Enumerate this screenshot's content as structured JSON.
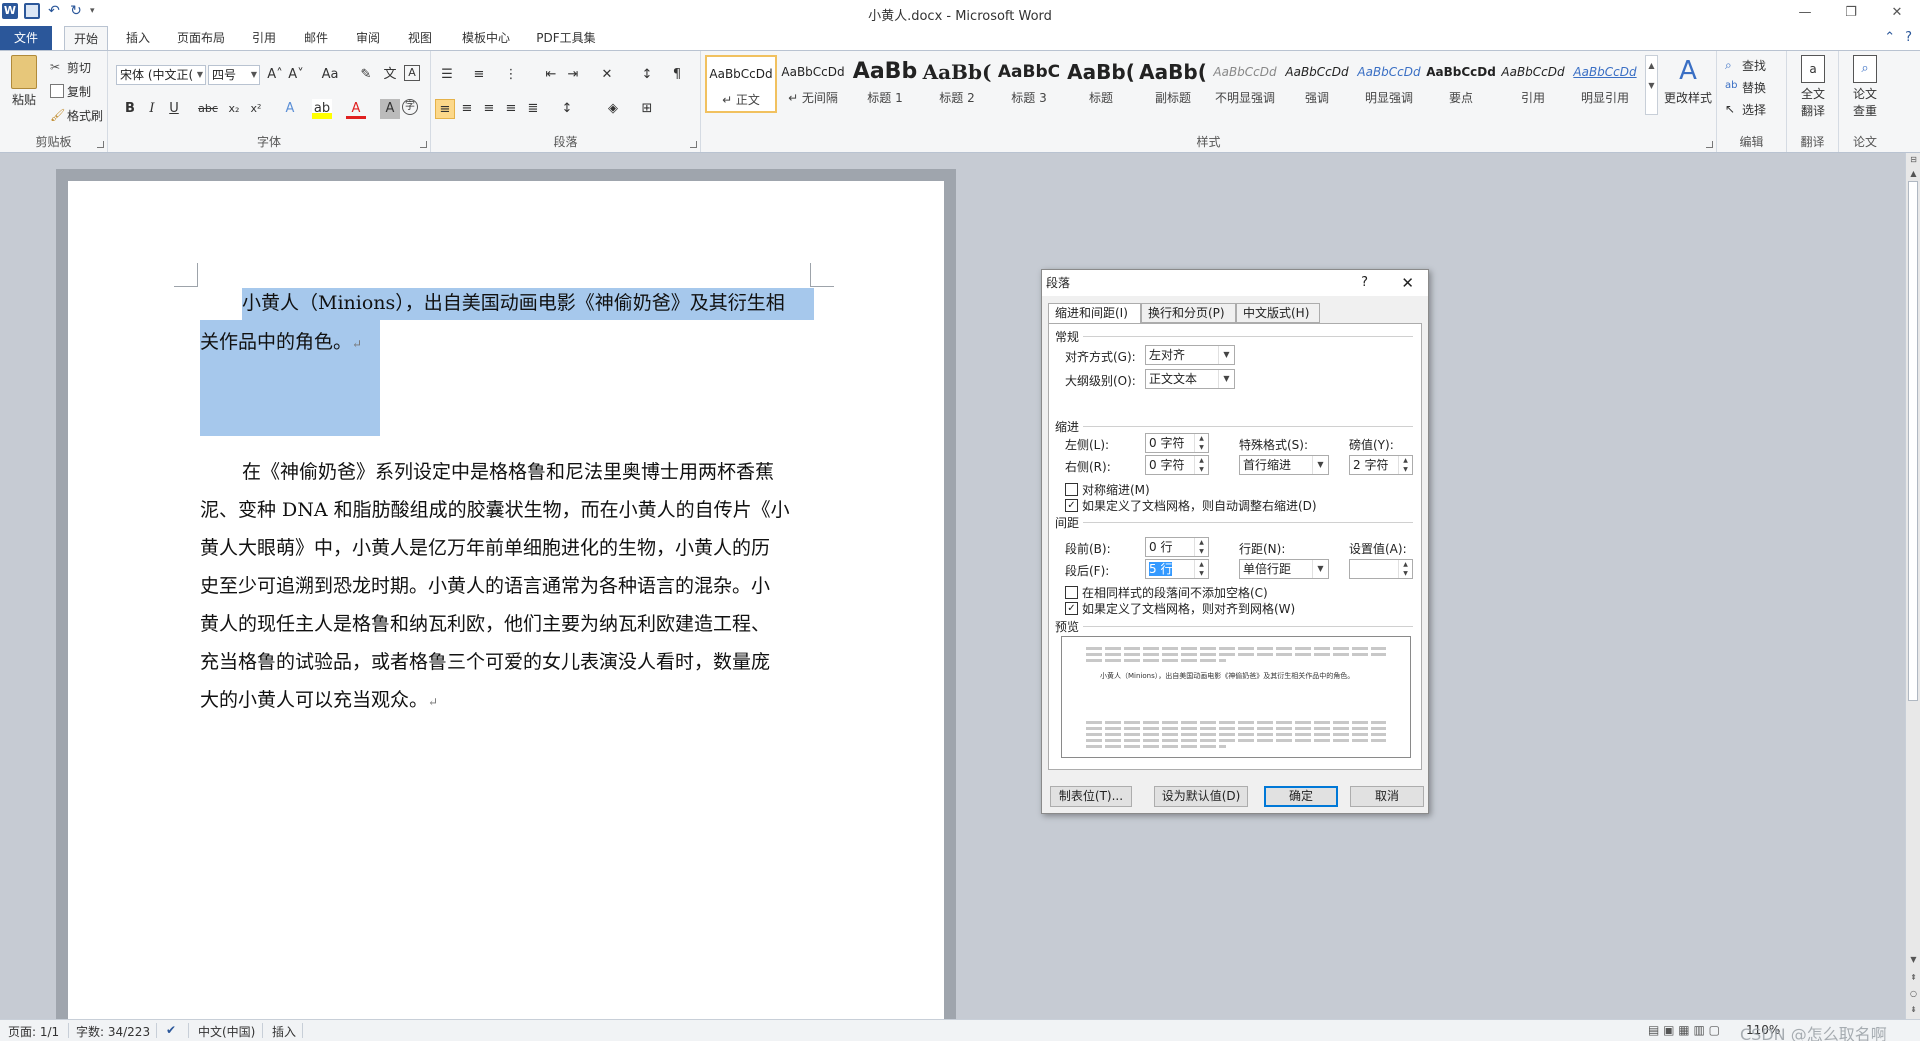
{
  "window": {
    "title": "小黄人.docx - Microsoft Word",
    "app_icon": "word-icon",
    "controls": [
      "minimize-icon",
      "restore-icon",
      "close-icon"
    ]
  },
  "tabs": [
    {
      "label": "文件"
    },
    {
      "label": "开始"
    },
    {
      "label": "插入"
    },
    {
      "label": "页面布局"
    },
    {
      "label": "引用"
    },
    {
      "label": "邮件"
    },
    {
      "label": "审阅"
    },
    {
      "label": "视图"
    },
    {
      "label": "模板中心"
    },
    {
      "label": "PDF工具集"
    }
  ],
  "ribbon": {
    "clipboard": {
      "label": "剪贴板",
      "paste": "粘贴",
      "cut": "剪切",
      "copy": "复制",
      "painter": "格式刷"
    },
    "font": {
      "label": "字体",
      "font_name": "宋体 (中文正(",
      "font_size": "四号"
    },
    "paragraph": {
      "label": "段落"
    },
    "styles": {
      "label": "样式",
      "items": [
        {
          "preview": "AaBbCcDd",
          "name": "↵ 正文"
        },
        {
          "preview": "AaBbCcDd",
          "name": "↵ 无间隔"
        },
        {
          "preview": "AaBb",
          "name": "标题 1"
        },
        {
          "preview": "AaBb(",
          "name": "标题 2"
        },
        {
          "preview": "AaBbC",
          "name": "标题 3"
        },
        {
          "preview": "AaBb(",
          "name": "标题"
        },
        {
          "preview": "AaBb(",
          "name": "副标题"
        },
        {
          "preview": "AaBbCcDd",
          "name": "不明显强调"
        },
        {
          "preview": "AaBbCcDd",
          "name": "强调"
        },
        {
          "preview": "AaBbCcDd",
          "name": "明显强调"
        },
        {
          "preview": "AaBbCcDd",
          "name": "要点"
        },
        {
          "preview": "AaBbCcDd",
          "name": "引用"
        },
        {
          "preview": "AaBbCcDd",
          "name": "明显引用"
        }
      ],
      "change": "更改样式"
    },
    "editing": {
      "label": "编辑",
      "find": "查找",
      "replace": "替换",
      "select": "选择"
    },
    "translate": {
      "label": "翻译",
      "full": "全文",
      "full2": "翻译"
    },
    "thesis": {
      "label": "论文",
      "check": "论文",
      "check2": "查重"
    }
  },
  "document": {
    "para1_line1": "小黄人（Minions），出自美国动画电影《神偷奶爸》及其衍生相",
    "para1_line2": "关作品中的角色。",
    "para2_lines": [
      "在《神偷奶爸》系列设定中是格格鲁和尼法里奥博士用两杯香蕉",
      "泥、变种 DNA 和脂肪酸组成的胶囊状生物，而在小黄人的自传片《小",
      "黄人大眼萌》中，小黄人是亿万年前单细胞进化的生物，小黄人的历",
      "史至少可追溯到恐龙时期。小黄人的语言通常为各种语言的混杂。小",
      "黄人的现任主人是格鲁和纳瓦利欧，他们主要为纳瓦利欧建造工程、",
      "充当格鲁的试验品，或者格鲁三个可爱的女儿表演没人看时，数量庞",
      "大的小黄人可以充当观众。"
    ],
    "para_mark": "↵"
  },
  "dialog": {
    "title": "段落",
    "help": "?",
    "tabs": [
      "缩进和间距(I)",
      "换行和分页(P)",
      "中文版式(H)"
    ],
    "general": {
      "title": "常规",
      "align_label": "对齐方式(G):",
      "align_value": "左对齐",
      "outline_label": "大纲级别(O):",
      "outline_value": "正文文本"
    },
    "indent": {
      "title": "缩进",
      "left_label": "左侧(L):",
      "left_value": "0 字符",
      "right_label": "右侧(R):",
      "right_value": "0 字符",
      "special_label": "特殊格式(S):",
      "special_value": "首行缩进",
      "by_label": "磅值(Y):",
      "by_value": "2 字符",
      "mirror": "对称缩进(M)",
      "auto_adjust": "如果定义了文档网格，则自动调整右缩进(D)"
    },
    "spacing": {
      "title": "间距",
      "before_label": "段前(B):",
      "before_value": "0 行",
      "after_label": "段后(F):",
      "after_value": "5 行",
      "line_label": "行距(N):",
      "line_value": "单倍行距",
      "at_label": "设置值(A):",
      "at_value": "",
      "no_space": "在相同样式的段落间不添加空格(C)",
      "snap_grid": "如果定义了文档网格，则对齐到网格(W)"
    },
    "preview": {
      "title": "预览",
      "sample": "小黄人（Minions），出自美国动画电影《神偷奶爸》及其衍生相关作品中的角色。"
    },
    "buttons": {
      "tabs": "制表位(T)...",
      "default": "设为默认值(D)",
      "ok": "确定",
      "cancel": "取消"
    }
  },
  "statusbar": {
    "page": "页面: 1/1",
    "words": "字数: 34/223",
    "lang": "中文(中国)",
    "mode": "插入",
    "zoom": "110%",
    "watermark": "CSDN @怎么取名啊"
  }
}
